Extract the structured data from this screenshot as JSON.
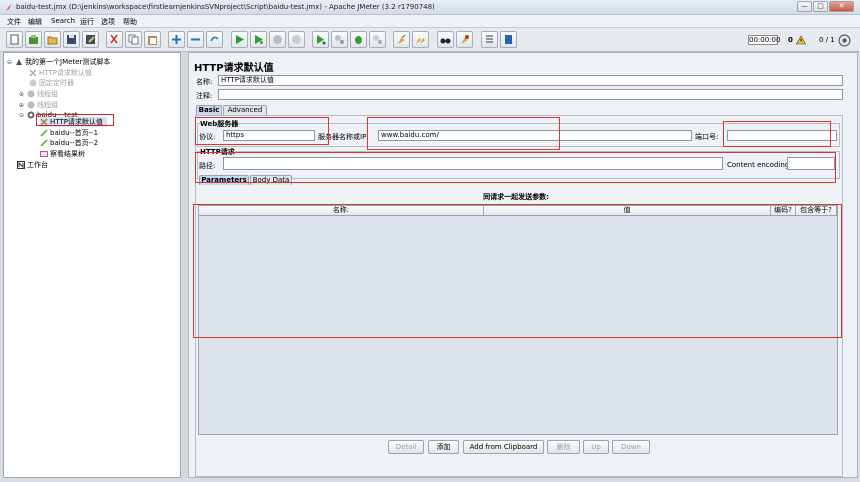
{
  "window": {
    "title": "baidu-test.jmx (D:\\jenkins\\workspace\\firstlearnjenkinsSVNproject\\Script\\baidu-test.jmx) - Apache JMeter (3.2 r1790748)",
    "minimize": "—",
    "maximize": "□",
    "close": "✕"
  },
  "menu": [
    "文件",
    "编辑",
    "Search",
    "运行",
    "选项",
    "帮助"
  ],
  "toolbar": {
    "timer": "00:00:00",
    "warning_count": "0",
    "threads": "0 / 1"
  },
  "tree": {
    "nodes": [
      {
        "label": "我的第一个JMeter测试脚本",
        "icon": "test-plan-icon",
        "expander": "⊖"
      },
      {
        "label": "HTTP请求默认值",
        "icon": "config-icon",
        "expander": ""
      },
      {
        "label": "固定定时器",
        "icon": "timer-icon",
        "expander": ""
      },
      {
        "label": "线程组",
        "icon": "thread-group-icon",
        "expander": "⊕"
      },
      {
        "label": "线程组",
        "icon": "thread-group-icon",
        "expander": "⊕"
      },
      {
        "label": "baidu---test",
        "icon": "thread-group-icon",
        "expander": "⊖"
      },
      {
        "label": "HTTP请求默认值",
        "icon": "config-icon",
        "expander": ""
      },
      {
        "label": "baidu--首页--1",
        "icon": "sampler-icon",
        "expander": ""
      },
      {
        "label": "baidu--首页--2",
        "icon": "sampler-icon",
        "expander": ""
      },
      {
        "label": "察看结果树",
        "icon": "listener-icon",
        "expander": ""
      },
      {
        "label": "工作台",
        "icon": "workbench-icon",
        "expander": ""
      }
    ]
  },
  "panel": {
    "title": "HTTP请求默认值",
    "name_label": "名称:",
    "name_value": "HTTP请求默认值",
    "comment_label": "注释:",
    "comment_value": "",
    "tabs": [
      "Basic",
      "Advanced"
    ],
    "web_server_group": "Web服务器",
    "protocol_label": "协议:",
    "protocol_value": "https",
    "server_label": "服务器名称或IP:",
    "server_value": "www.baidu.com/",
    "port_label": "端口号:",
    "port_value": "",
    "http_request_group": "HTTP请求",
    "path_label": "路径:",
    "path_value": "",
    "encoding_label": "Content encoding:",
    "encoding_value": "",
    "subtabs": [
      "Parameters",
      "Body Data"
    ],
    "args_caption": "同请求一起发送参数:",
    "columns": [
      "名称:",
      "值",
      "编码?",
      "包含等于?"
    ],
    "buttons": [
      "Detail",
      "添加",
      "Add from Clipboard",
      "删除",
      "Up",
      "Down"
    ]
  }
}
